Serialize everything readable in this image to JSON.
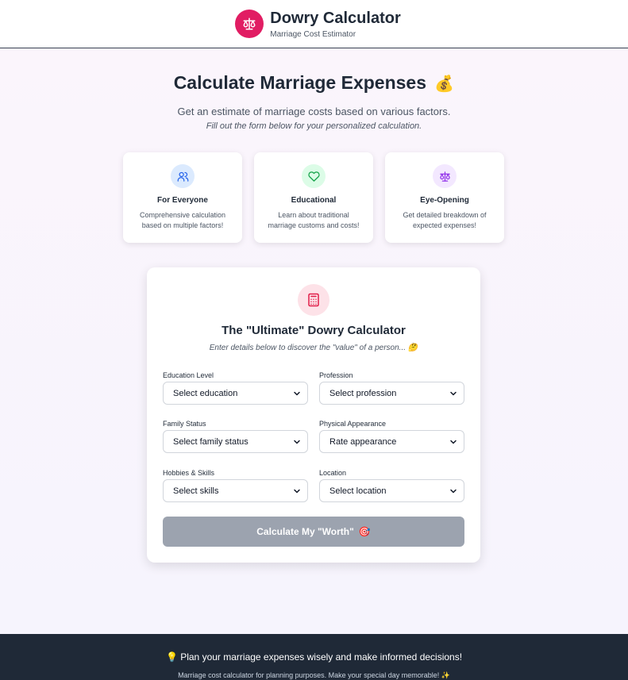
{
  "header": {
    "title": "Dowry Calculator",
    "subtitle": "Marriage Cost Estimator",
    "logo_icon": "scale-icon",
    "logo_color": "#e11d63"
  },
  "hero": {
    "title": "Calculate Marriage Expenses",
    "title_emoji": "💰",
    "subtitle": "Get an estimate of marriage costs based on various factors.",
    "subtitle_italic": "Fill out the form below for your personalized calculation."
  },
  "features": [
    {
      "icon": "users-icon",
      "title": "For Everyone",
      "desc": "Comprehensive calculation based on multiple factors!"
    },
    {
      "icon": "heart-icon",
      "title": "Educational",
      "desc": "Learn about traditional marriage customs and costs!"
    },
    {
      "icon": "scale-icon",
      "title": "Eye-Opening",
      "desc": "Get detailed breakdown of expected expenses!"
    }
  ],
  "calculator": {
    "icon": "calculator-icon",
    "title": "The \"Ultimate\" Dowry Calculator",
    "subtitle": "Enter details below to discover the \"value\" of a person... 🤔",
    "fields": [
      {
        "label": "Education Level",
        "value": "Select education"
      },
      {
        "label": "Profession",
        "value": "Select profession"
      },
      {
        "label": "Family Status",
        "value": "Select family status"
      },
      {
        "label": "Physical Appearance",
        "value": "Rate appearance"
      },
      {
        "label": "Hobbies & Skills",
        "value": "Select skills"
      },
      {
        "label": "Location",
        "value": "Select location"
      }
    ],
    "button_label": "Calculate My \"Worth\"",
    "button_emoji": "🎯",
    "button_color": "#9ca3af"
  },
  "footer": {
    "main": "💡 Plan your marriage expenses wisely and make informed decisions!",
    "sub": "Marriage cost calculator for planning purposes. Make your special day memorable! ✨"
  }
}
